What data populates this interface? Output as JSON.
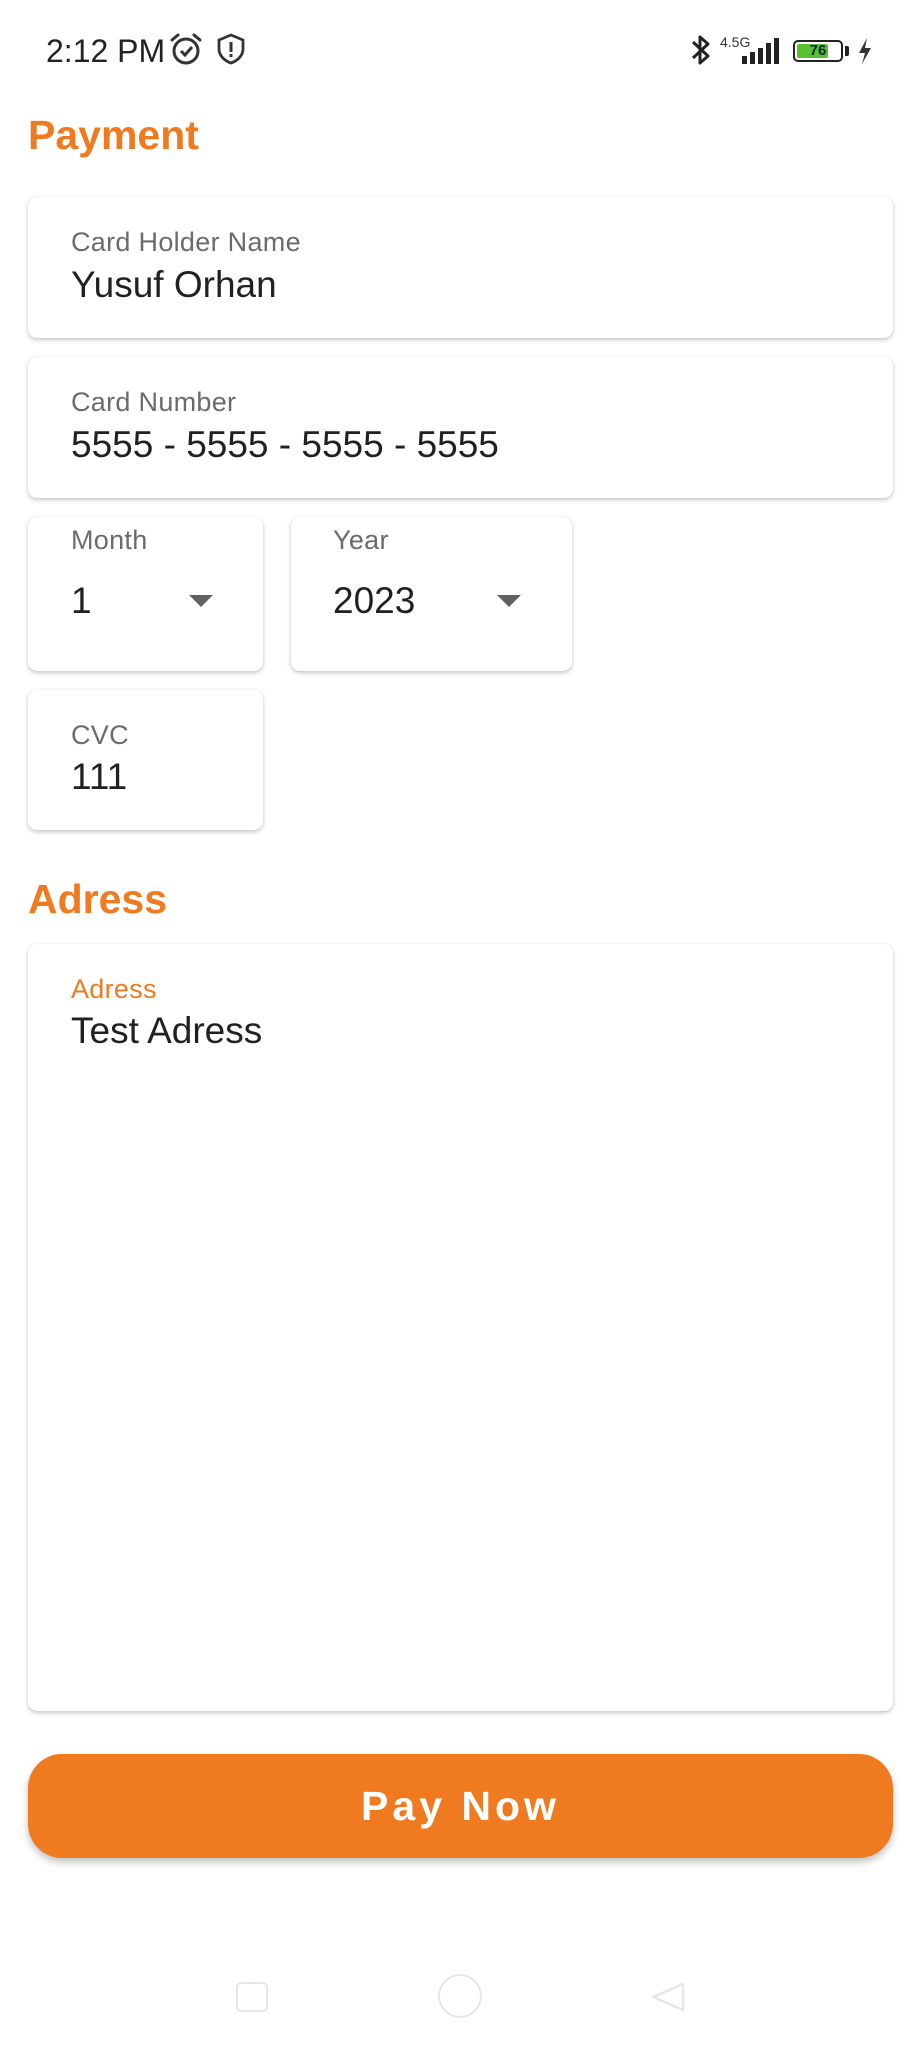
{
  "status_bar": {
    "time": "2:12 PM",
    "network": "4.5G",
    "battery": "76",
    "battery_level": 0.76,
    "icons": [
      "alarm-icon",
      "shield-alert-icon",
      "bluetooth-icon",
      "signal-icon",
      "battery-icon",
      "charging-icon"
    ]
  },
  "payment": {
    "title": "Payment",
    "card_holder": {
      "label": "Card Holder Name",
      "value": "Yusuf Orhan"
    },
    "card_number": {
      "label": "Card Number",
      "value": "5555 - 5555 - 5555 - 5555"
    },
    "month": {
      "label": "Month",
      "value": "1"
    },
    "year": {
      "label": "Year",
      "value": "2023"
    },
    "cvc": {
      "label": "CVC",
      "value": "111"
    }
  },
  "address": {
    "title": "Adress",
    "field": {
      "label": "Adress",
      "value": "Test Adress"
    }
  },
  "pay_button": {
    "label": "Pay Now"
  },
  "colors": {
    "accent": "#f07a20",
    "text": "#212121",
    "label": "#6b6b6b",
    "battery_fill": "#55c12e"
  },
  "nav_bar": {
    "icons": [
      "recents-square-icon",
      "home-circle-icon",
      "back-triangle-icon"
    ]
  }
}
